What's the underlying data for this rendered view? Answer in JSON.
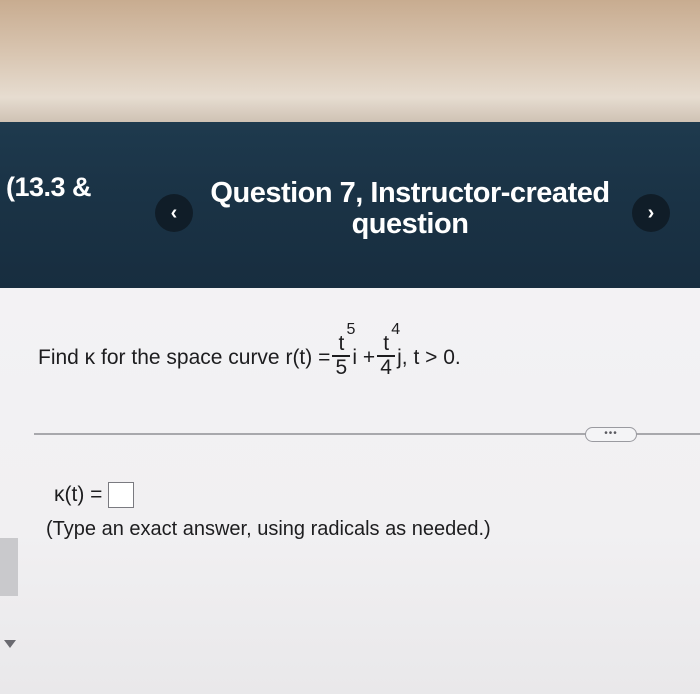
{
  "header": {
    "breadcrumb": "(13.3 &",
    "prev_symbol": "‹",
    "next_symbol": "›",
    "title_line1": "Question 7, Instructor-created",
    "title_line2": "question"
  },
  "question": {
    "prefix": "Find κ for the space curve r(t) =",
    "term1_numerator": "t",
    "term1_exponent": "5",
    "term1_denominator": "5",
    "term1_unit": "i +",
    "term2_numerator": "t",
    "term2_exponent": "4",
    "term2_denominator": "4",
    "term2_unit": "j, t > 0."
  },
  "more_button": "•••",
  "answer": {
    "label": "κ(t) =",
    "value": ""
  },
  "hint": "(Type an exact answer, using radicals as needed.)",
  "colors": {
    "header_bg": "#1b3447",
    "nav_button_bg": "#101d28",
    "content_bg": "#f1f0f2"
  }
}
